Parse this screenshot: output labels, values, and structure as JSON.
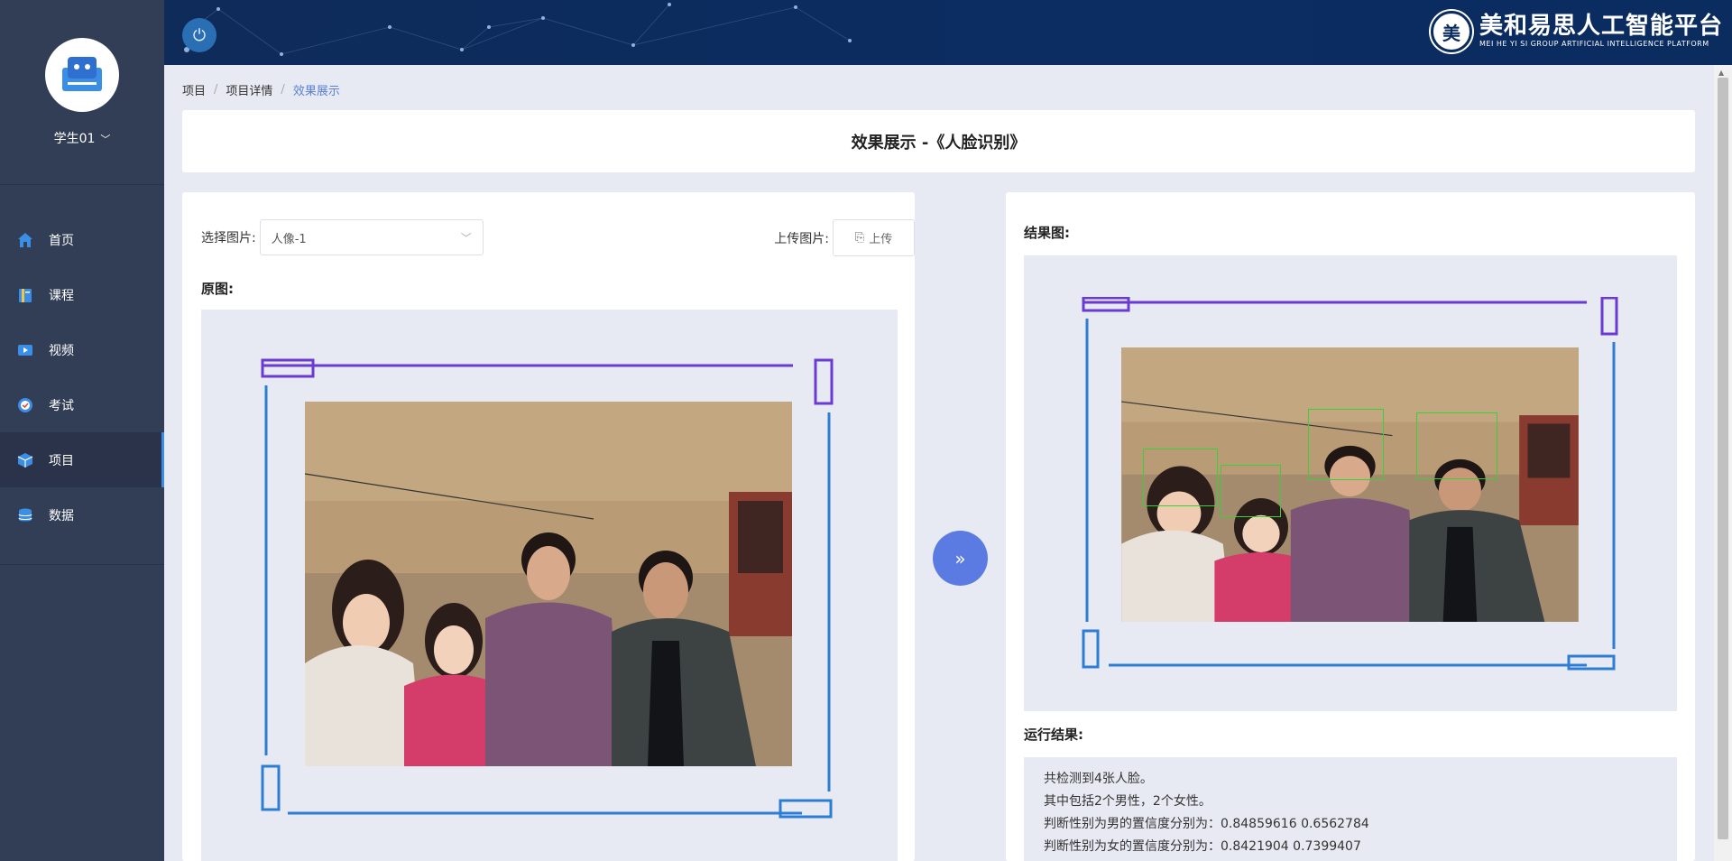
{
  "user": {
    "name": "学生01"
  },
  "sidebar": {
    "items": [
      {
        "label": "首页",
        "icon": "home-icon"
      },
      {
        "label": "课程",
        "icon": "course-icon"
      },
      {
        "label": "视频",
        "icon": "video-icon"
      },
      {
        "label": "考试",
        "icon": "exam-icon"
      },
      {
        "label": "项目",
        "icon": "project-icon",
        "active": true
      },
      {
        "label": "数据",
        "icon": "data-icon"
      }
    ]
  },
  "header": {
    "brand_cn": "美和易思人工智能平台",
    "brand_en": "MEI HE YI SI GROUP ARTIFICIAL INTELLIGENCE PLATFORM",
    "seal_char": "美"
  },
  "breadcrumb": [
    "项目",
    "项目详情",
    "效果展示"
  ],
  "page_title": "效果展示 -《人脸识别》",
  "left_panel": {
    "select_label": "选择图片:",
    "select_value": "人像-1",
    "upload_label": "上传图片:",
    "upload_button": "上传",
    "original_label": "原图:"
  },
  "right_panel": {
    "result_label": "结果图:",
    "run_label": "运行结果:",
    "run_lines": [
      "共检测到4张人脸。",
      "其中包括2个男性，2个女性。",
      "判断性别为男的置信度分别为：0.84859616 0.6562784",
      "判断性别为女的置信度分别为：0.8421904 0.7399407"
    ]
  },
  "colors": {
    "accent": "#3a8ee6",
    "sidebar_bg": "#323d56",
    "header_bg": "#0b2c5f",
    "arrow_btn": "#5b7be3",
    "face_box": "#39d039"
  }
}
